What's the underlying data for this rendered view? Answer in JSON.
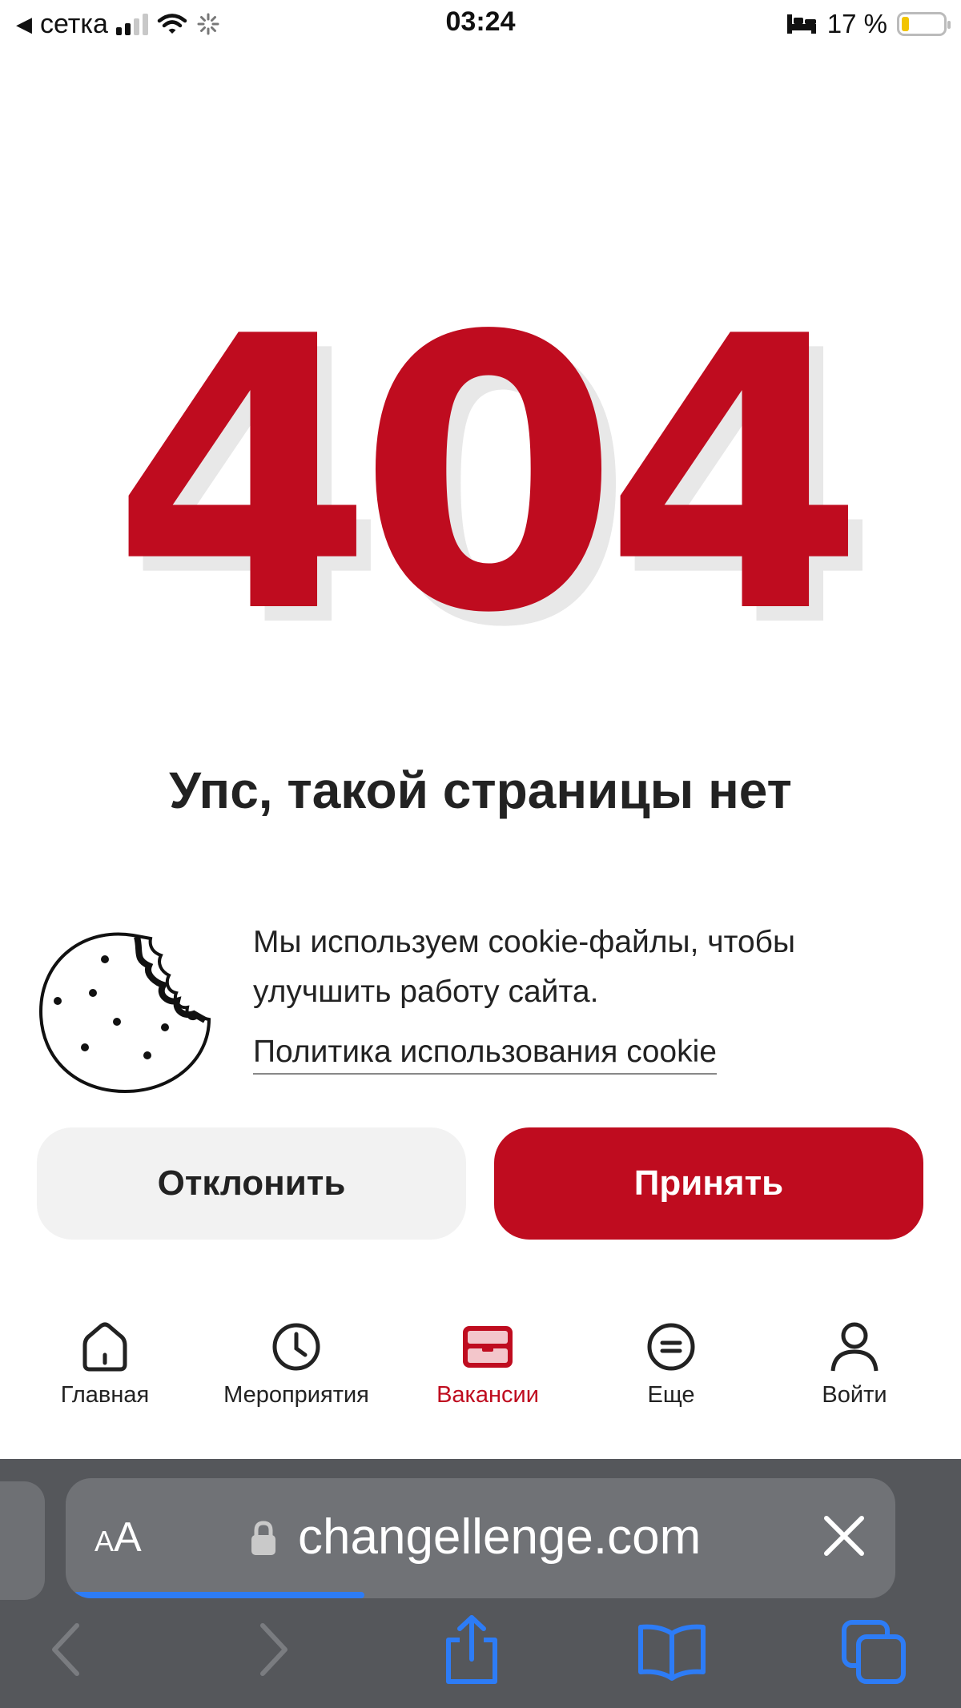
{
  "status_bar": {
    "back_label": "◀",
    "carrier": "сетка",
    "time": "03:24",
    "battery_text": "17 %",
    "battery_level": 0.17
  },
  "error": {
    "code": "404",
    "message": "Упс, такой страницы нет"
  },
  "cookie": {
    "text": "Мы используем cookie-файлы, чтобы улучшить работу сайта.",
    "policy_link": "Политика использования cookie",
    "decline_label": "Отклонить",
    "accept_label": "Принять"
  },
  "tabbar": {
    "items": [
      {
        "label": "Главная",
        "icon": "home-icon",
        "active": false
      },
      {
        "label": "Мероприятия",
        "icon": "clock-icon",
        "active": false
      },
      {
        "label": "Вакансии",
        "icon": "briefcase-icon",
        "active": true
      },
      {
        "label": "Еще",
        "icon": "more-icon",
        "active": false
      },
      {
        "label": "Войти",
        "icon": "user-icon",
        "active": false
      }
    ]
  },
  "browser": {
    "text_size_big": "A",
    "text_size_small": "A",
    "url": "changellenge.com",
    "load_progress": 0.35
  },
  "colors": {
    "brand_red": "#bf0c1f",
    "accent_blue": "#2d7cf6",
    "chrome_gray": "#55575b"
  }
}
